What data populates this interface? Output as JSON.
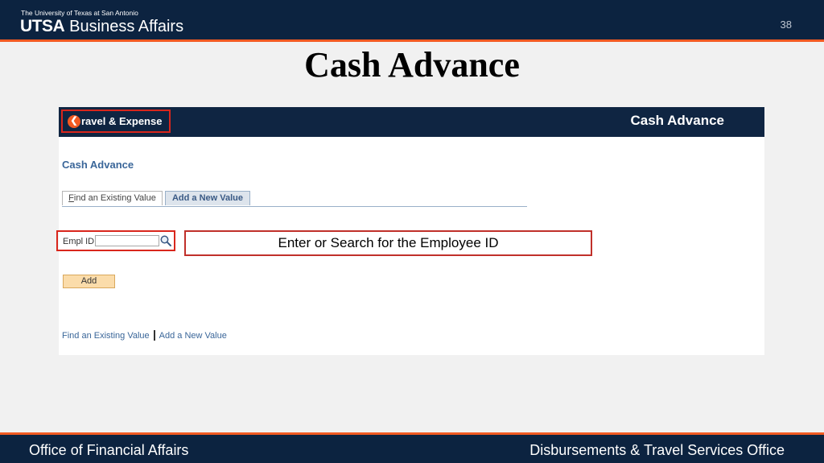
{
  "header": {
    "university_line": "The University of Texas at San Antonio",
    "brand_utsa": "UTSA",
    "brand_suffix": "Business Affairs",
    "page_number": "38"
  },
  "slide_title": "Cash Advance",
  "app": {
    "back_button_icon": "chevron-left-circle-icon",
    "back_button_label": "ravel & Expense",
    "topbar_title": "Cash Advance",
    "page_heading": "Cash Advance",
    "tabs": [
      {
        "accesskey": "F",
        "label_rest": "ind an Existing Value"
      },
      {
        "label": "Add a New Value"
      }
    ],
    "empl_id_label": "Empl ID",
    "empl_id_value": "",
    "search_icon": "magnifier-icon",
    "callout_text": "Enter or Search for the Employee ID",
    "add_button_label": "Add",
    "bottom_links": {
      "find_label": "Find an Existing Value",
      "add_label": "Add a New Value"
    },
    "colors": {
      "header_navy": "#0c2340",
      "accent_orange": "#f15a22",
      "highlight_red": "#d9261c",
      "link_blue": "#3a6699"
    }
  },
  "footer": {
    "left": "Office of Financial Affairs",
    "right": "Disbursements & Travel Services Office"
  }
}
